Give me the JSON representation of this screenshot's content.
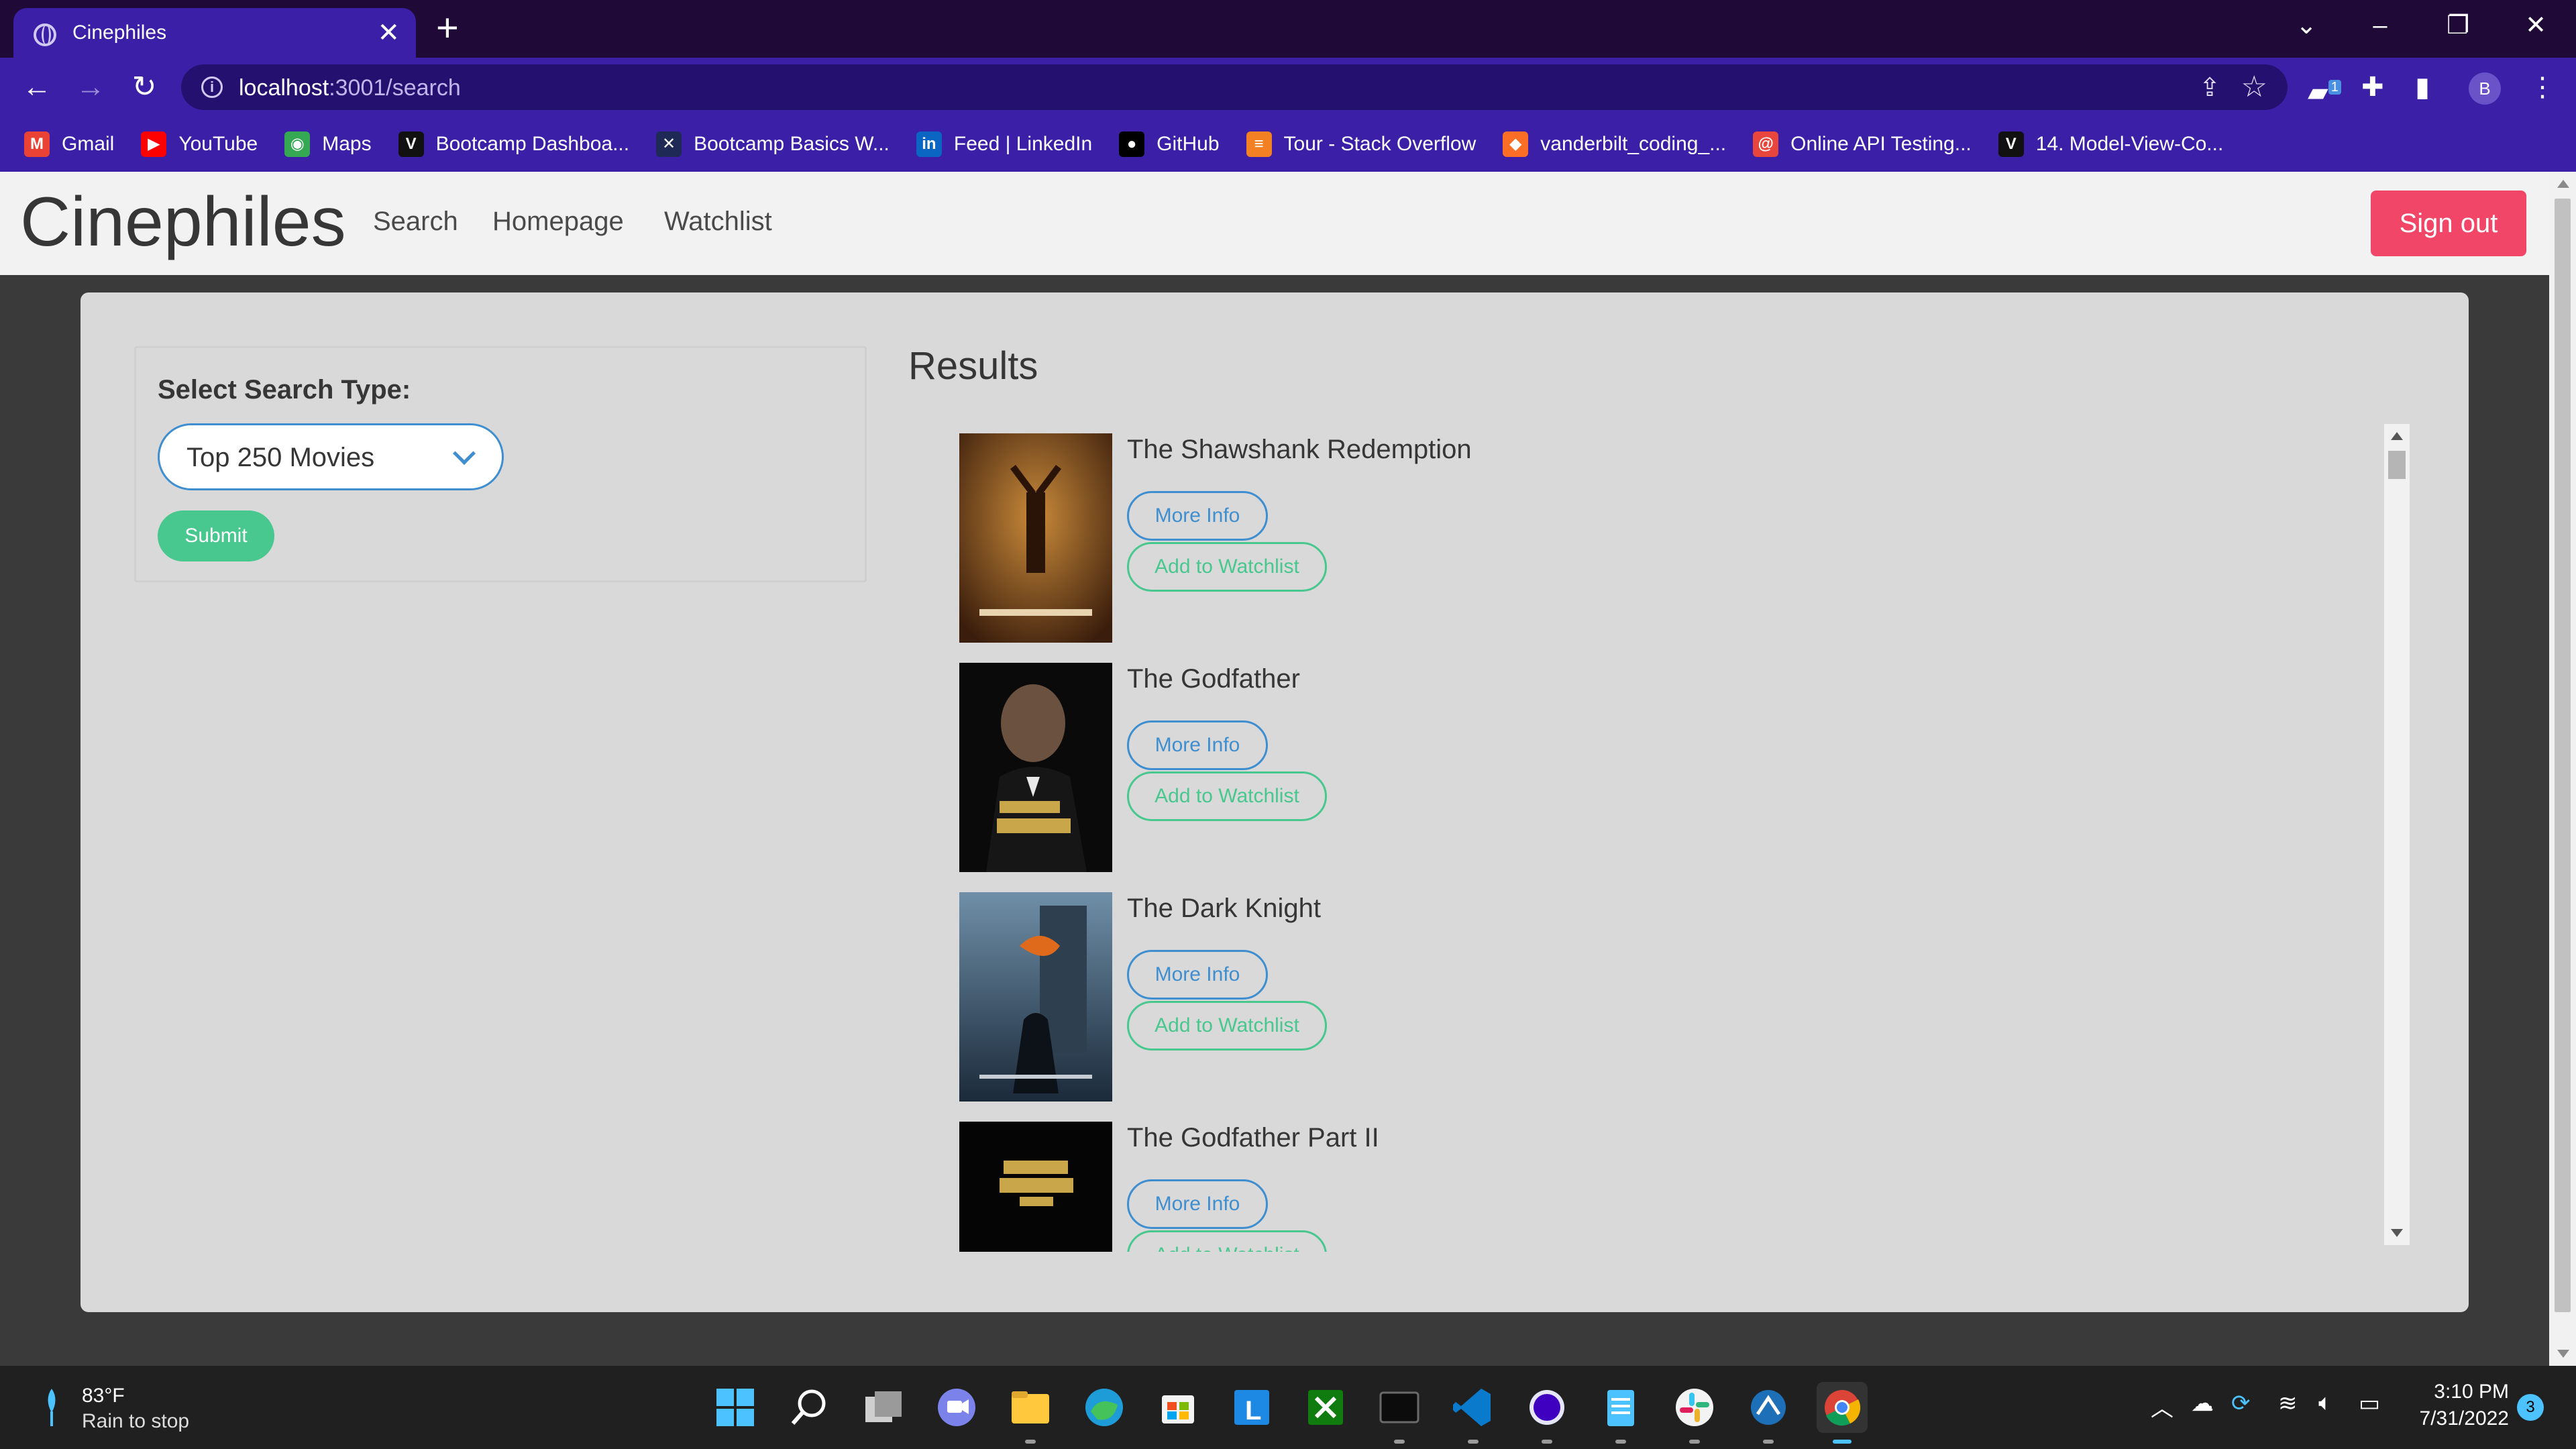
{
  "browser": {
    "tab_title": "Cinephiles",
    "url_host": "localhost",
    "url_rest": ":3001/search",
    "profile_initial": "B",
    "extension_badge": "1",
    "bookmarks": [
      {
        "label": "Gmail",
        "icon": "gmail-icon",
        "color": "#ea4335"
      },
      {
        "label": "YouTube",
        "icon": "youtube-icon",
        "color": "#ff0000"
      },
      {
        "label": "Maps",
        "icon": "maps-icon",
        "color": "#34a853"
      },
      {
        "label": "Bootcamp Dashboa...",
        "icon": "vanderbilt-icon",
        "color": "#111111"
      },
      {
        "label": "Bootcamp Basics W...",
        "icon": "bootcamp-basics-icon",
        "color": "#1e2a55"
      },
      {
        "label": "Feed | LinkedIn",
        "icon": "linkedin-icon",
        "color": "#0a66c2"
      },
      {
        "label": "GitHub",
        "icon": "github-icon",
        "color": "#000000"
      },
      {
        "label": "Tour - Stack Overflow",
        "icon": "stackoverflow-icon",
        "color": "#f48024"
      },
      {
        "label": "vanderbilt_coding_...",
        "icon": "gitlab-icon",
        "color": "#fc6d26"
      },
      {
        "label": "Online API Testing...",
        "icon": "api-testing-icon",
        "color": "#e8453c"
      },
      {
        "label": "14. Model-View-Co...",
        "icon": "vanderbilt-icon",
        "color": "#111111"
      }
    ]
  },
  "navbar": {
    "brand": "Cinephiles",
    "links": [
      "Search",
      "Homepage",
      "Watchlist"
    ],
    "signout": "Sign out"
  },
  "search": {
    "label": "Select Search Type:",
    "selected": "Top 250 Movies",
    "submit": "Submit"
  },
  "results": {
    "title": "Results",
    "more_info": "More Info",
    "add_watchlist": "Add to Watchlist",
    "movies": [
      {
        "title": "The Shawshank Redemption"
      },
      {
        "title": "The Godfather"
      },
      {
        "title": "The Dark Knight"
      },
      {
        "title": "The Godfather Part II"
      }
    ]
  },
  "taskbar": {
    "temperature": "83°F",
    "condition": "Rain to stop",
    "time": "3:10 PM",
    "date": "7/31/2022",
    "notification_count": "3"
  },
  "colors": {
    "accent_purple": "#3b1fa6",
    "signout_red": "#f14668",
    "link_blue": "#3e8ed0",
    "success_green": "#48c78e"
  }
}
